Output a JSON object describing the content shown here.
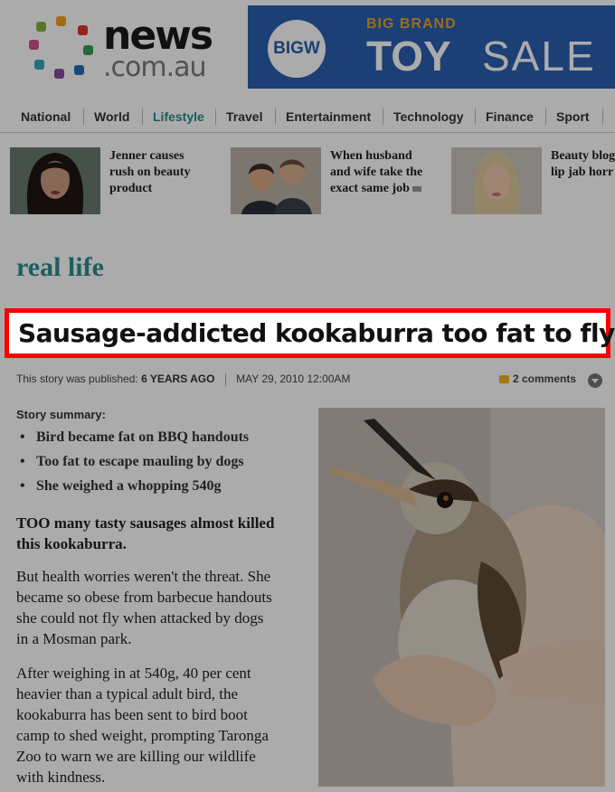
{
  "logo": {
    "word1": "news",
    "word2": ".com.au"
  },
  "ad": {
    "brand": "BIGW",
    "kicker": "BIG BRAND",
    "word1": "TOY",
    "word2": "SALE"
  },
  "nav": [
    "National",
    "World",
    "Lifestyle",
    "Travel",
    "Entertainment",
    "Technology",
    "Finance",
    "Sport"
  ],
  "nav_active": "Lifestyle",
  "teasers": [
    {
      "line1": "Jenner causes",
      "line2": "rush on beauty",
      "line3": "product"
    },
    {
      "line1": "When husband",
      "line2": "and wife take the",
      "line3": "exact same job"
    },
    {
      "line1": "Beauty blog",
      "line2": "lip jab horr",
      "line3": ""
    }
  ],
  "section_title": "real life",
  "headline": "Sausage-addicted kookaburra too fat to fly",
  "meta": {
    "published_label": "This story was published:",
    "age": "6 YEARS AGO",
    "date": "MAY 29, 2010 12:00AM"
  },
  "comments": "2 comments",
  "summary": {
    "label": "Story summary:",
    "items": [
      "Bird became fat on BBQ handouts",
      "Too fat to escape mauling by dogs",
      "She weighed a whopping 540g"
    ]
  },
  "body": {
    "lead_line1": "TOO many tasty sausages almost killed",
    "lead_line2": "this kookaburra.",
    "p1": [
      "But health worries weren't the threat. She",
      "became so obese from barbecue handouts",
      "she could not fly when attacked by dogs",
      "in a Mosman park."
    ],
    "p2": [
      "After weighing in at 540g, 40 per cent",
      "heavier than a typical adult bird, the",
      "kookaburra has been sent to bird boot",
      "camp to shed weight, prompting Taronga",
      "Zoo to warn we are killing our wildlife",
      "with kindness."
    ]
  },
  "colors": {
    "highlight_border": "#ff0000",
    "section": "#2b8e8e",
    "nav_active": "#2a8a8a",
    "ad_bg": "#2a5fb0"
  }
}
